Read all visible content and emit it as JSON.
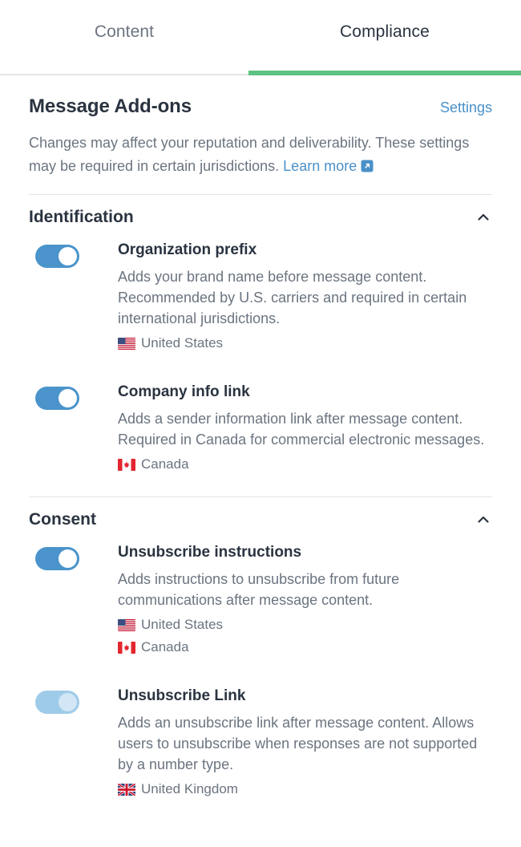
{
  "tabs": [
    {
      "label": "Content",
      "active": false,
      "name": "tab-content"
    },
    {
      "label": "Compliance",
      "active": true,
      "name": "tab-compliance"
    }
  ],
  "panel": {
    "title": "Message Add-ons",
    "settings_label": "Settings",
    "description": "Changes may affect your reputation and deliverability. These settings may be required in certain jurisdictions.",
    "learn_more_label": "Learn more",
    "learn_more_icon": "external-link-icon"
  },
  "colors": {
    "accent_green": "#5dc283",
    "link_blue": "#4a90c8",
    "toggle_on": "#4a94cb",
    "toggle_disabled": "#9ecbe8",
    "text_dark": "#2a3340",
    "text_muted": "#6b7480",
    "divider": "#e1e4e8"
  },
  "sections": [
    {
      "title": "Identification",
      "collapse_icon": "chevron-up-icon",
      "expanded": true,
      "options": [
        {
          "name": "Organization prefix",
          "description": "Adds your brand name before message content. Recommended by U.S. carriers and required in certain international jurisdictions.",
          "toggle_state": "on",
          "toggle_disabled": false,
          "regions": [
            {
              "label": "United States",
              "flag": "flag-us"
            }
          ]
        },
        {
          "name": "Company info link",
          "description": "Adds a sender information link after message content. Required in Canada for commercial electronic messages.",
          "toggle_state": "on",
          "toggle_disabled": false,
          "regions": [
            {
              "label": "Canada",
              "flag": "flag-ca"
            }
          ]
        }
      ]
    },
    {
      "title": "Consent",
      "collapse_icon": "chevron-up-icon",
      "expanded": true,
      "options": [
        {
          "name": "Unsubscribe instructions",
          "description": "Adds instructions to unsubscribe from future communications after message content.",
          "toggle_state": "on",
          "toggle_disabled": false,
          "regions": [
            {
              "label": "United States",
              "flag": "flag-us"
            },
            {
              "label": "Canada",
              "flag": "flag-ca"
            }
          ]
        },
        {
          "name": "Unsubscribe Link",
          "description": "Adds an unsubscribe link after message content. Allows users to unsubscribe when responses are not supported by a number type.",
          "toggle_state": "on",
          "toggle_disabled": true,
          "regions": [
            {
              "label": "United Kingdom",
              "flag": "flag-gb"
            }
          ]
        }
      ]
    }
  ]
}
